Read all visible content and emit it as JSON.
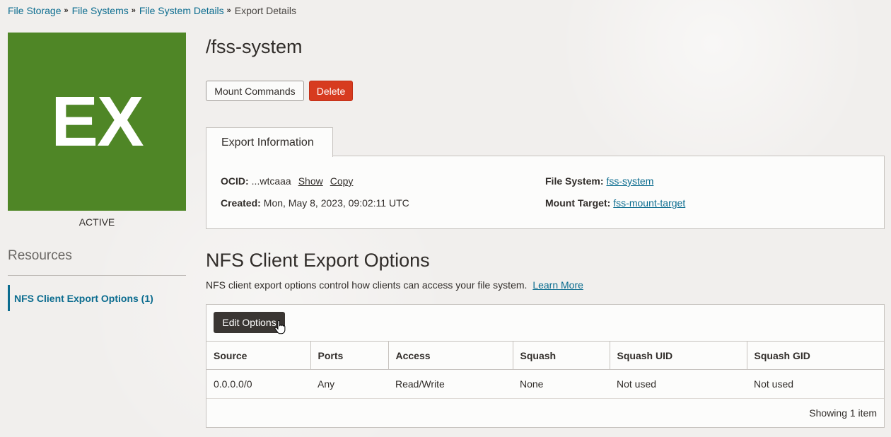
{
  "breadcrumb": {
    "items": [
      "File Storage",
      "File Systems",
      "File System Details"
    ],
    "current": "Export Details",
    "separator": "»"
  },
  "resource": {
    "badge_text": "EX",
    "badge_color": "#4f8626",
    "status": "ACTIVE",
    "title": "/fss-system"
  },
  "actions": {
    "mount_commands": "Mount Commands",
    "delete": "Delete"
  },
  "tabs": {
    "export_information": "Export Information"
  },
  "info": {
    "ocid_label": "OCID:",
    "ocid_value": "...wtcaaa",
    "show": "Show",
    "copy": "Copy",
    "created_label": "Created:",
    "created_value": "Mon, May 8, 2023, 09:02:11 UTC",
    "file_system_label": "File System:",
    "file_system_value": "fss-system",
    "mount_target_label": "Mount Target:",
    "mount_target_value": "fss-mount-target"
  },
  "sidebar": {
    "resources_heading": "Resources",
    "items": [
      {
        "label": "NFS Client Export Options (1)",
        "active": true
      }
    ]
  },
  "nfs_section": {
    "title": "NFS Client Export Options",
    "description": "NFS client export options control how clients can access your file system.",
    "learn_more": "Learn More",
    "edit_button": "Edit Options",
    "columns": [
      "Source",
      "Ports",
      "Access",
      "Squash",
      "Squash UID",
      "Squash GID"
    ],
    "rows": [
      [
        "0.0.0.0/0",
        "Any",
        "Read/Write",
        "None",
        "Not used",
        "Not used"
      ]
    ],
    "footer": "Showing 1 item"
  },
  "colors": {
    "link": "#0b6c8f",
    "delete": "#d73b1f",
    "primary_dark": "#3a3633"
  }
}
